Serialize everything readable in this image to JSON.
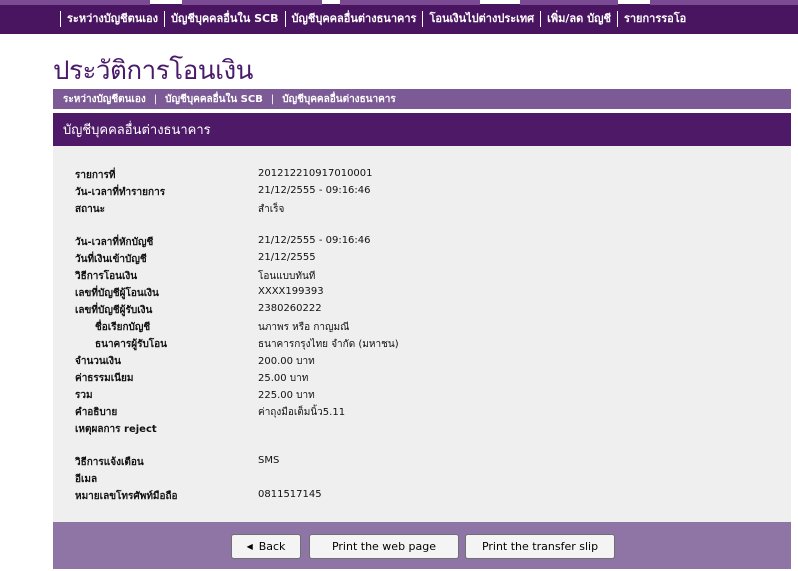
{
  "top_nav": {
    "items": [
      "ระหว่างบัญชีตนเอง",
      "บัญชีบุคคลอื่นใน SCB",
      "บัญชีบุคคลอื่นต่างธนาคาร",
      "โอนเงินไปต่างประเทศ",
      "เพิ่ม/ลด บัญชี",
      "รายการรอโอ"
    ]
  },
  "page_title": "ประวัติการโอนเงิน",
  "sub_nav": {
    "items": [
      "ระหว่างบัญชีตนเอง",
      "บัญชีบุคคลอื่นใน SCB",
      "บัญชีบุคคลอื่นต่างธนาคาร"
    ],
    "separator": "|"
  },
  "section_header": "บัญชีบุคคลอื่นต่างธนาคาร",
  "details": [
    {
      "label": "รายการที่",
      "value": "201212210917010001"
    },
    {
      "label": "วัน-เวลาที่ทำรายการ",
      "value": "21/12/2555 - 09:16:46"
    },
    {
      "label": "สถานะ",
      "value": "สำเร็จ"
    },
    {
      "label": "วัน-เวลาที่หักบัญชี",
      "value": "21/12/2555 - 09:16:46"
    },
    {
      "label": "วันที่เงินเข้าบัญชี",
      "value": "21/12/2555"
    },
    {
      "label": "วิธีการโอนเงิน",
      "value": "โอนแบบทันที"
    },
    {
      "label": "เลขที่บัญชีผู้โอนเงิน",
      "value": "XXXX199393"
    },
    {
      "label": "เลขที่บัญชีผู้รับเงิน",
      "value": "2380260222"
    },
    {
      "label": "ชื่อเรียกบัญชี",
      "value": "นภาพร หรือ กาญมณี"
    },
    {
      "label": "ธนาคารผู้รับโอน",
      "value": "ธนาคารกรุงไทย จำกัด (มหาชน)"
    },
    {
      "label": "จำนวนเงิน",
      "value": "200.00 บาท"
    },
    {
      "label": "ค่าธรรมเนียม",
      "value": "25.00 บาท"
    },
    {
      "label": "รวม",
      "value": "225.00 บาท"
    },
    {
      "label": "คำอธิบาย",
      "value": "ค่าถุงมือเต็มนิ้ว5.11"
    },
    {
      "label": "เหตุผลการ reject",
      "value": ""
    },
    {
      "label": "วิธีการแจ้งเตือน",
      "value": "SMS"
    },
    {
      "label": "อีเมล",
      "value": ""
    },
    {
      "label": "หมายเลขโทรศัพท์มือถือ",
      "value": "0811517145"
    }
  ],
  "buttons": {
    "back": "Back",
    "print_web": "Print the web page",
    "print_slip": "Print the transfer slip"
  },
  "colors": {
    "nav_purple": "#4a1560",
    "sub_nav_purple": "#7b5a96",
    "header_purple": "#4e1a68",
    "footer_purple": "#8e75a6",
    "content_gray": "#efefef"
  }
}
